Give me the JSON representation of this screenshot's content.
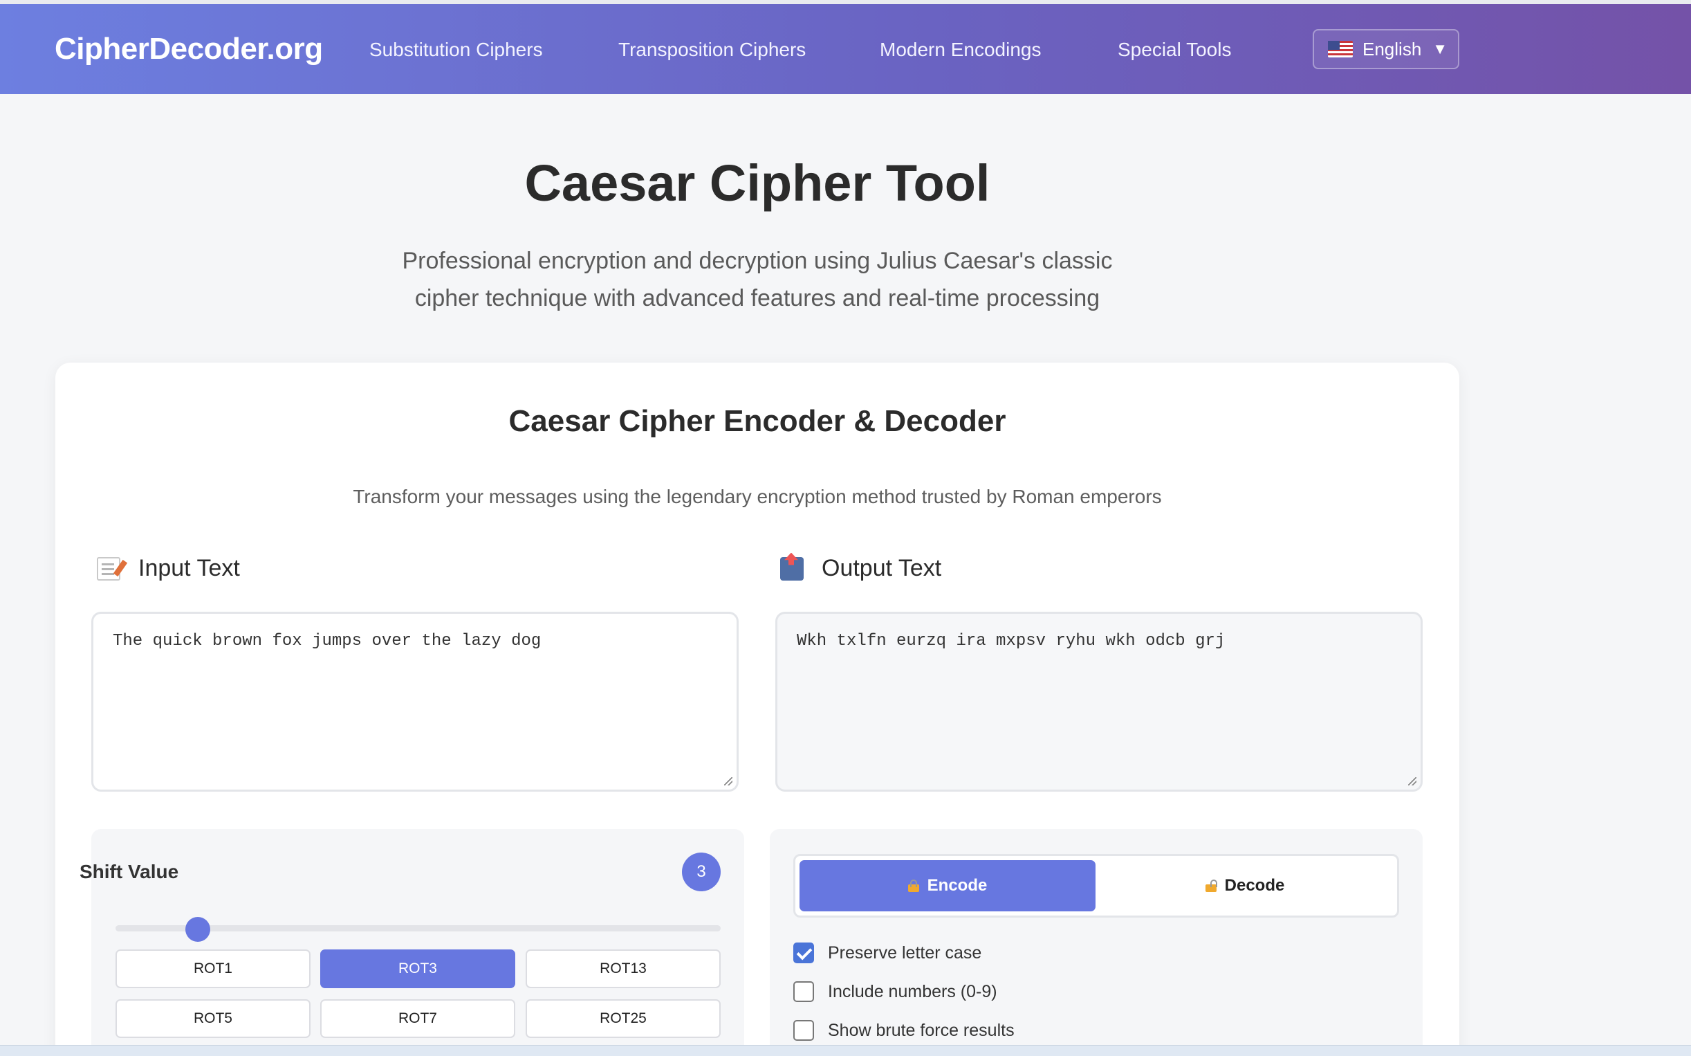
{
  "header": {
    "logo": "CipherDecoder.org",
    "nav": [
      "Substitution Ciphers",
      "Transposition Ciphers",
      "Modern Encodings",
      "Special Tools"
    ],
    "language": "English"
  },
  "page": {
    "title": "Caesar Cipher Tool",
    "subtitle": "Professional encryption and decryption using Julius Caesar's classic cipher technique with advanced features and real-time processing"
  },
  "tool": {
    "title": "Caesar Cipher Encoder & Decoder",
    "subtitle": "Transform your messages using the legendary encryption method trusted by Roman emperors",
    "input_label": "Input Text",
    "input_value": "The quick brown fox jumps over the lazy dog",
    "output_label": "Output Text",
    "output_value": "Wkh txlfn eurzq ira mxpsv ryhu wkh odcb grj"
  },
  "shift": {
    "label": "Shift Value",
    "value": "3",
    "slider_value": 3,
    "slider_max": 25,
    "presets": [
      "ROT1",
      "ROT3",
      "ROT13",
      "ROT5",
      "ROT7",
      "ROT25"
    ],
    "active_preset": "ROT3"
  },
  "mode": {
    "encode": "Encode",
    "decode": "Decode",
    "active": "Encode"
  },
  "options": [
    {
      "label": "Preserve letter case",
      "checked": true
    },
    {
      "label": "Include numbers (0-9)",
      "checked": false
    },
    {
      "label": "Show brute force results",
      "checked": false
    }
  ],
  "colors": {
    "accent": "#6777e0",
    "header_start": "#6d7fe0",
    "header_end": "#7452a8",
    "checkbox": "#4a74d8"
  }
}
